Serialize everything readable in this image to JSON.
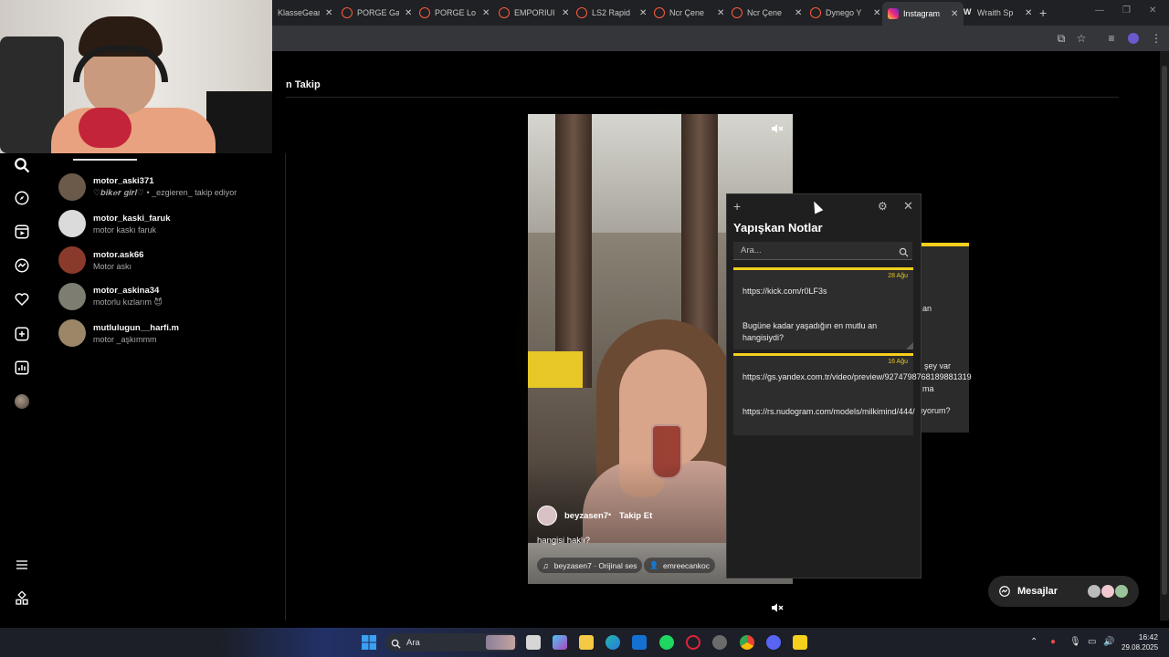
{
  "browser": {
    "tabs": [
      {
        "title": "KlasseGear",
        "icon": "none"
      },
      {
        "title": "PORGE Ga",
        "icon": "porge-icon"
      },
      {
        "title": "PORGE Lo",
        "icon": "porge-icon"
      },
      {
        "title": "EMPORIUI",
        "icon": "porge-icon"
      },
      {
        "title": "LS2 Rapid",
        "icon": "porge-icon"
      },
      {
        "title": "Ncr Çene",
        "icon": "porge-icon"
      },
      {
        "title": "Ncr Çene",
        "icon": "porge-icon"
      },
      {
        "title": "Dynego Y",
        "icon": "porge-icon"
      },
      {
        "title": "Instagram",
        "icon": "instagram-icon",
        "active": true
      },
      {
        "title": "Wraith Sp",
        "icon": "w-icon"
      }
    ],
    "close_glyph": "✕",
    "new_tab_glyph": "+"
  },
  "instagram": {
    "header_label": "n  Takip",
    "search_results": [
      {
        "username": "motor_aski371",
        "subtitle": "♡𝒃𝒊𝒌𝒆𝒓 𝒈𝒊𝒓𝒍♡ • _ezgieren_ takip ediyor",
        "avatar_color": "#6b5a4a"
      },
      {
        "username": "motor_kaski_faruk",
        "subtitle": "motor kaskı faruk",
        "avatar_color": "#dbdbdb"
      },
      {
        "username": "motor.ask66",
        "subtitle": "Motor askı",
        "avatar_color": "#8a3a2a"
      },
      {
        "username": "motor_askina34",
        "subtitle": "motorlu kızlarım 😈",
        "avatar_color": "#7d7d72"
      },
      {
        "username": "mutlulugun__harfi.m",
        "subtitle": "motor _aşkımmm",
        "avatar_color": "#9c8668"
      }
    ],
    "reel": {
      "username": "beyzasen7",
      "dot": "•",
      "follow_label": "Takip Et",
      "caption": "hangisi haklı?",
      "audio": "beyzasen7 · Orijinal ses",
      "tagged": "emreecankoc"
    },
    "messages_label": "Mesajlar"
  },
  "sticky_notes": {
    "title": "Yapışkan Notlar",
    "search_placeholder": "Ara...",
    "notes": [
      {
        "date": "28 Ağu",
        "lines": [
          "https://kick.com/r0LF3s",
          "",
          "Bugüne kadar yaşadığın en mutlu an hangisiydi?"
        ]
      },
      {
        "date": "16 Ağu",
        "lines": [
          "https://gs.yandex.com.tr/video/preview/9274798768189881319",
          "",
          "https://rs.nudogram.com/models/milkimind/444/"
        ]
      }
    ],
    "back_window_fragments": [
      "an",
      "şey var",
      "ma",
      "ıyorum?"
    ]
  },
  "taskbar": {
    "search_label": "Ara",
    "time": "16:42",
    "date": "29.08.2025"
  },
  "colors": {
    "sticky_accent": "#f4d01d",
    "instagram_bg": "#000000",
    "taskbar_bg": "#1c1f27"
  }
}
